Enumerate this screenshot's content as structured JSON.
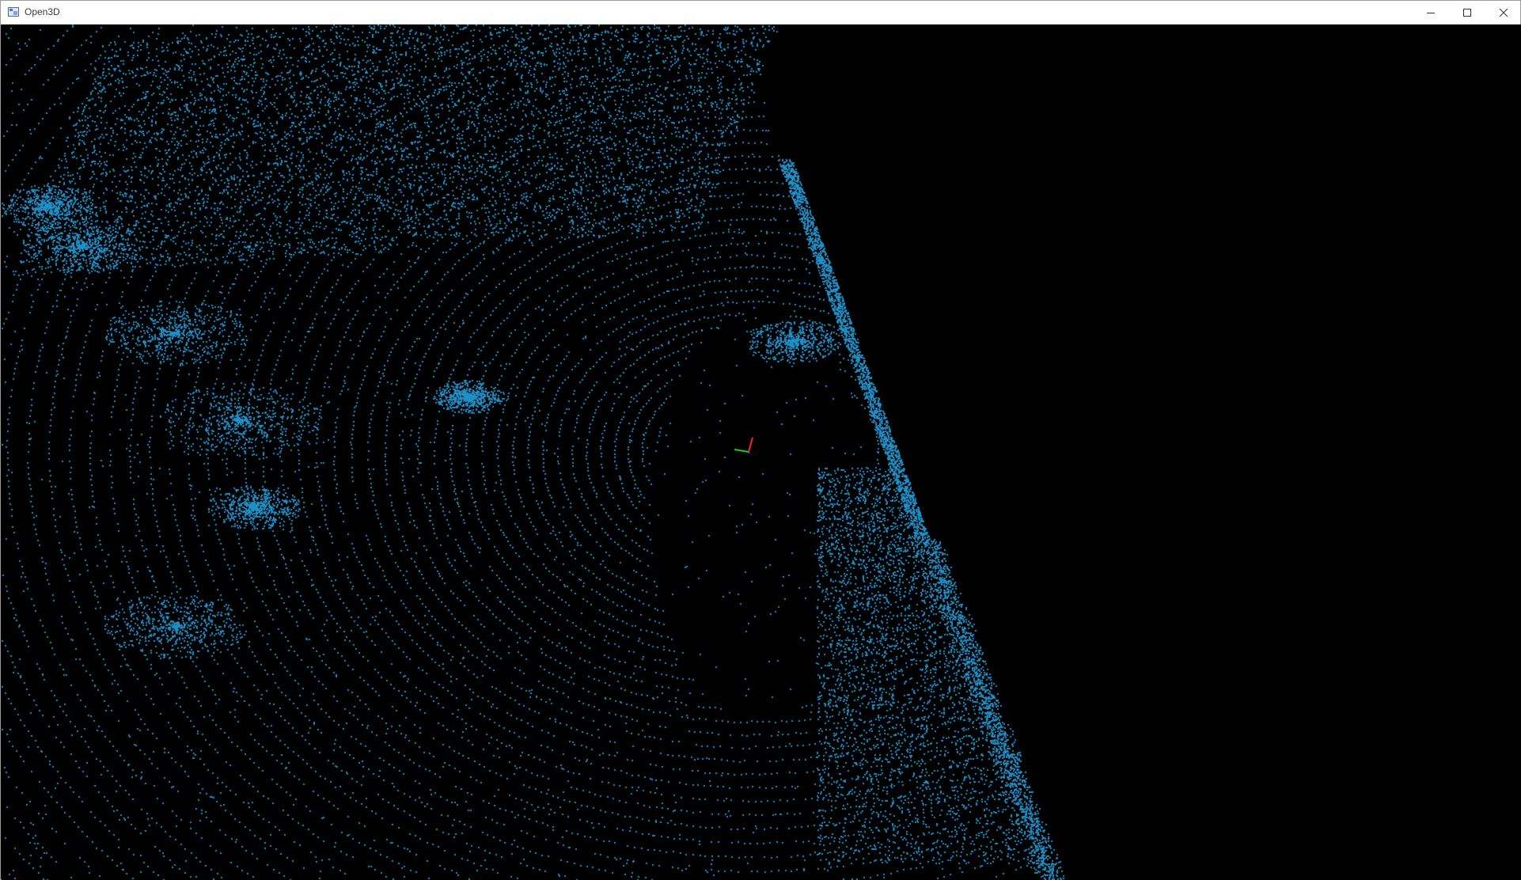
{
  "window": {
    "title": "Open3D",
    "controls": {
      "minimize": "minimize",
      "maximize": "maximize",
      "close": "close"
    }
  },
  "viewer": {
    "background_color": "#000000",
    "point_color": "#1e90c8",
    "axes": {
      "x_color": "#ff2020",
      "y_color": "#10d010",
      "z_color": "#2050ff"
    }
  }
}
